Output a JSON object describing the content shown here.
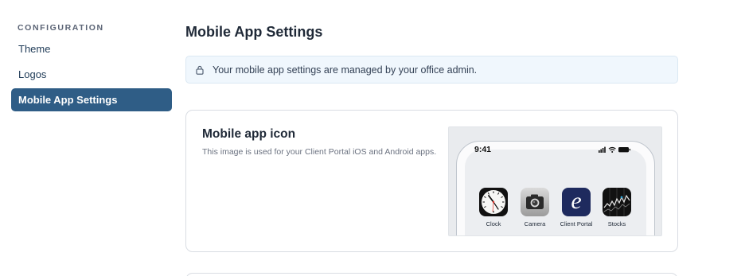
{
  "sidebar": {
    "heading": "CONFIGURATION",
    "items": [
      {
        "label": "Theme"
      },
      {
        "label": "Logos"
      },
      {
        "label": "Mobile App Settings"
      }
    ]
  },
  "main": {
    "title": "Mobile App Settings",
    "notice": {
      "icon": "lock-icon",
      "text": "Your mobile app settings are managed by your office admin."
    },
    "card": {
      "title": "Mobile app icon",
      "description": "This image is used for your Client Portal iOS and Android apps.",
      "preview": {
        "time": "9:41",
        "status_icons": [
          "signal-icon",
          "wifi-icon",
          "battery-icon"
        ],
        "apps": [
          {
            "label": "Clock",
            "icon": "clock-icon"
          },
          {
            "label": "Camera",
            "icon": "camera-icon"
          },
          {
            "label": "Client Portal",
            "icon": "client-portal-icon",
            "glyph": "e"
          },
          {
            "label": "Stocks",
            "icon": "stocks-icon"
          }
        ]
      }
    }
  },
  "colors": {
    "active_nav": "#2f5d86",
    "notice_bg": "#f0f7fd",
    "client_portal_icon": "#1e2a5e"
  }
}
